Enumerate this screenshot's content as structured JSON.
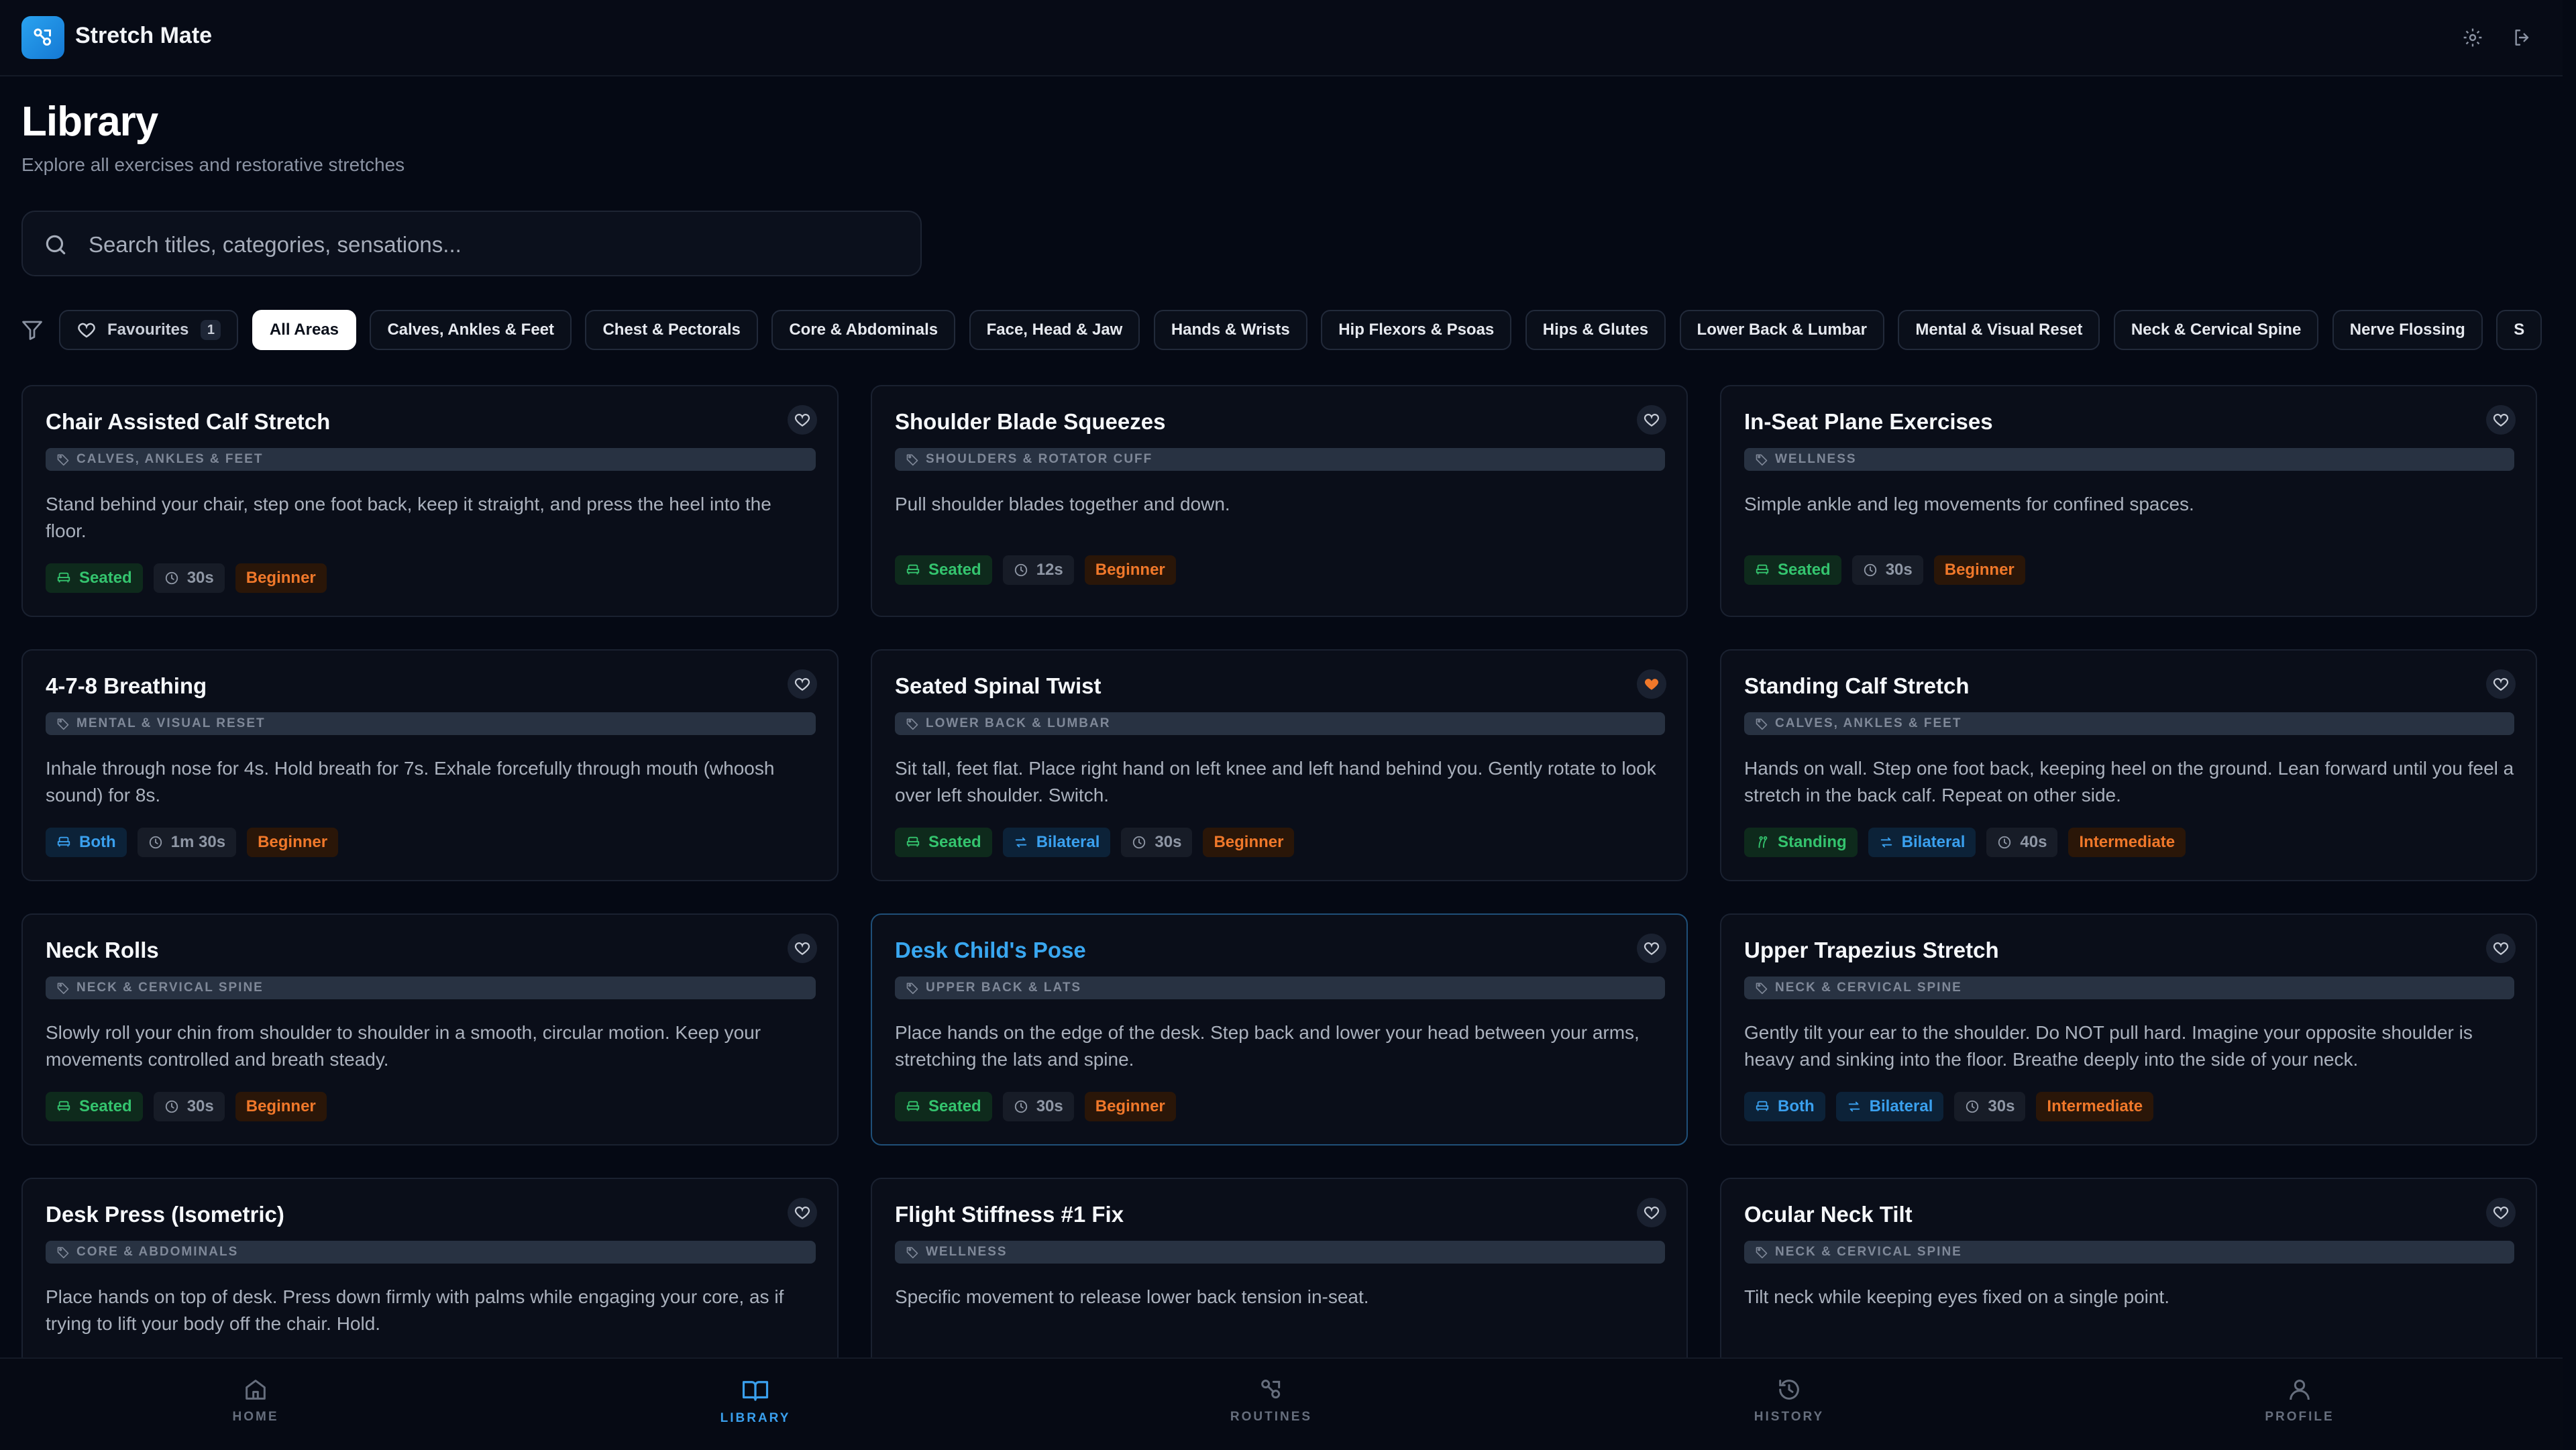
{
  "app": {
    "title": "Stretch Mate"
  },
  "page": {
    "title": "Library",
    "subtitle": "Explore all exercises and restorative stretches"
  },
  "search": {
    "placeholder": "Search titles, categories, sensations..."
  },
  "filters": {
    "favourites": {
      "label": "Favourites",
      "count": "1"
    },
    "chips": [
      "All Areas",
      "Calves, Ankles & Feet",
      "Chest & Pectorals",
      "Core & Abdominals",
      "Face, Head & Jaw",
      "Hands & Wrists",
      "Hip Flexors & Psoas",
      "Hips & Glutes",
      "Lower Back & Lumbar",
      "Mental & Visual Reset",
      "Neck & Cervical Spine",
      "Nerve Flossing",
      "S"
    ],
    "active": "All Areas"
  },
  "cards": [
    {
      "title": "Chair Assisted Calf Stretch",
      "category": "CALVES, ANKLES & FEET",
      "description": "Stand behind your chair, step one foot back, keep it straight, and press the heel into the floor.",
      "position": "Seated",
      "duration": "30s",
      "level": "Beginner",
      "favourite": false
    },
    {
      "title": "Shoulder Blade Squeezes",
      "category": "SHOULDERS & ROTATOR CUFF",
      "description": "Pull shoulder blades together and down.",
      "position": "Seated",
      "duration": "12s",
      "level": "Beginner",
      "favourite": false
    },
    {
      "title": "In-Seat Plane Exercises",
      "category": "WELLNESS",
      "description": "Simple ankle and leg movements for confined spaces.",
      "position": "Seated",
      "duration": "30s",
      "level": "Beginner",
      "favourite": false
    },
    {
      "title": "4-7-8 Breathing",
      "category": "MENTAL & VISUAL RESET",
      "description": "Inhale through nose for 4s. Hold breath for 7s. Exhale forcefully through mouth (whoosh sound) for 8s.",
      "position": "Both",
      "duration": "1m 30s",
      "level": "Beginner",
      "favourite": false
    },
    {
      "title": "Seated Spinal Twist",
      "category": "LOWER BACK & LUMBAR",
      "description": "Sit tall, feet flat. Place right hand on left knee and left hand behind you. Gently rotate to look over left shoulder. Switch.",
      "position": "Seated",
      "side": "Bilateral",
      "duration": "30s",
      "level": "Beginner",
      "favourite": true
    },
    {
      "title": "Standing Calf Stretch",
      "category": "CALVES, ANKLES & FEET",
      "description": "Hands on wall. Step one foot back, keeping heel on the ground. Lean forward until you feel a stretch in the back calf. Repeat on other side.",
      "position": "Standing",
      "side": "Bilateral",
      "duration": "40s",
      "level": "Intermediate",
      "favourite": false
    },
    {
      "title": "Neck Rolls",
      "category": "NECK & CERVICAL SPINE",
      "description": "Slowly roll your chin from shoulder to shoulder in a smooth, circular motion. Keep your movements controlled and breath steady.",
      "position": "Seated",
      "duration": "30s",
      "level": "Beginner",
      "favourite": false
    },
    {
      "title": "Desk Child's Pose",
      "category": "UPPER BACK & LATS",
      "description": "Place hands on the edge of the desk. Step back and lower your head between your arms, stretching the lats and spine.",
      "position": "Seated",
      "duration": "30s",
      "level": "Beginner",
      "favourite": false,
      "highlight": true
    },
    {
      "title": "Upper Trapezius Stretch",
      "category": "NECK & CERVICAL SPINE",
      "description": "Gently tilt your ear to the shoulder. Do NOT pull hard. Imagine your opposite shoulder is heavy and sinking into the floor. Breathe deeply into the side of your neck.",
      "position": "Both",
      "side": "Bilateral",
      "duration": "30s",
      "level": "Intermediate",
      "favourite": false
    },
    {
      "title": "Desk Press (Isometric)",
      "category": "CORE & ABDOMINALS",
      "description": "Place hands on top of desk. Press down firmly with palms while engaging your core, as if trying to lift your body off the chair. Hold.",
      "favourite": false
    },
    {
      "title": "Flight Stiffness #1 Fix",
      "category": "WELLNESS",
      "description": "Specific movement to release lower back tension in-seat.",
      "favourite": false
    },
    {
      "title": "Ocular Neck Tilt",
      "category": "NECK & CERVICAL SPINE",
      "description": "Tilt neck while keeping eyes fixed on a single point.",
      "favourite": false
    }
  ],
  "nav": [
    {
      "label": "HOME",
      "icon": "home-icon"
    },
    {
      "label": "LIBRARY",
      "icon": "book-icon",
      "active": true
    },
    {
      "label": "ROUTINES",
      "icon": "routines-icon"
    },
    {
      "label": "HISTORY",
      "icon": "history-icon"
    },
    {
      "label": "PROFILE",
      "icon": "profile-icon"
    }
  ],
  "colors": {
    "accent": "#3aa0ee",
    "favourite": "#f0782a",
    "success": "#34c46e"
  }
}
